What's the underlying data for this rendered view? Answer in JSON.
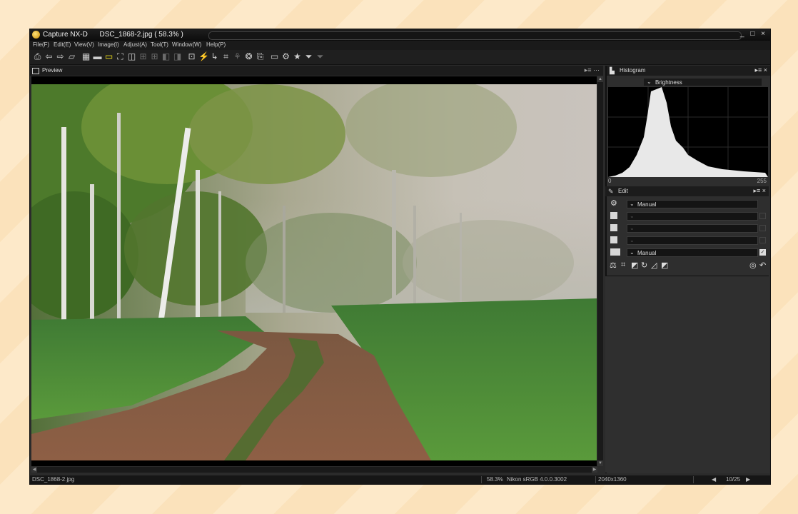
{
  "window": {
    "app_name": "Capture NX-D",
    "document_title": "DSC_1868-2.jpg ( 58.3% )",
    "controls": "_ □ ×"
  },
  "menu": [
    {
      "label": "File(F)",
      "key": "file"
    },
    {
      "label": "Edit(E)",
      "key": "edit"
    },
    {
      "label": "View(V)",
      "key": "view"
    },
    {
      "label": "Image(I)",
      "key": "image"
    },
    {
      "label": "Adjust(A)",
      "key": "adjust"
    },
    {
      "label": "Tool(T)",
      "key": "tool"
    },
    {
      "label": "Window(W)",
      "key": "window"
    },
    {
      "label": "Help(P)",
      "key": "help"
    }
  ],
  "toolbar": [
    {
      "name": "print-icon",
      "glyph": "⎙"
    },
    {
      "name": "back-icon",
      "glyph": "⇦"
    },
    {
      "name": "forward-icon",
      "glyph": "⇨"
    },
    {
      "name": "open-folder-icon",
      "glyph": "▱"
    },
    {
      "name": "thumbnail-grid-icon",
      "glyph": "▦"
    },
    {
      "name": "filmstrip-icon",
      "glyph": "▬"
    },
    {
      "name": "single-view-icon",
      "glyph": "▭",
      "selected": true
    },
    {
      "name": "full-screen-icon",
      "glyph": "⛶"
    },
    {
      "name": "compare-two-icon",
      "glyph": "◫"
    },
    {
      "name": "compare-four-icon",
      "glyph": "⊞",
      "dim": true
    },
    {
      "name": "compare-grid-icon",
      "glyph": "⊞",
      "dim": true
    },
    {
      "name": "before-after-icon",
      "glyph": "◧",
      "dim": true
    },
    {
      "name": "split-view-icon",
      "glyph": "◨",
      "dim": true
    },
    {
      "name": "focus-point-icon",
      "glyph": "⊡"
    },
    {
      "name": "highlights-icon",
      "glyph": "⚡",
      "dim": true
    },
    {
      "name": "straighten-icon",
      "glyph": "↳"
    },
    {
      "name": "crop-icon",
      "glyph": "⌗"
    },
    {
      "name": "color-picker-icon",
      "glyph": "⚘",
      "dim": true
    },
    {
      "name": "dust-off-icon",
      "glyph": "❂"
    },
    {
      "name": "copy-adjust-icon",
      "glyph": "⎘"
    },
    {
      "name": "slideshow-icon",
      "glyph": "▭"
    },
    {
      "name": "batch-process-icon",
      "glyph": "⚙"
    },
    {
      "name": "rating-star-icon",
      "glyph": "★"
    },
    {
      "name": "filter-icon",
      "glyph": "⏷"
    },
    {
      "name": "filter-off-icon",
      "glyph": "⏷",
      "dim": true
    }
  ],
  "preview": {
    "title": "Preview",
    "header_controls": "▸≡ ⋯"
  },
  "histogram": {
    "title": "Histogram",
    "channel": "Brightness",
    "scale_min": "0",
    "scale_max": "255",
    "header_controls": "▸≡ ×"
  },
  "edit": {
    "title": "Edit",
    "header_controls": "▸≡ ×",
    "rows": [
      {
        "icon": "gear-icon",
        "value": "Manual",
        "enabled": true,
        "checkbox": false
      },
      {
        "icon": "exposure-icon",
        "value": "",
        "enabled": false,
        "checkbox": false
      },
      {
        "icon": "white-balance-icon",
        "value": "",
        "enabled": false,
        "checkbox": false
      },
      {
        "icon": "picture-control-icon",
        "value": "",
        "enabled": false,
        "checkbox": false
      },
      {
        "icon": "levels-icon",
        "value": "Manual",
        "enabled": true,
        "checkbox": true
      }
    ]
  },
  "status_bar": {
    "filename": "DSC_1868-2.jpg",
    "zoom": "58.3%",
    "color_profile": "Nikon sRGB 4.0.0.3002",
    "dimensions": "2040x1360",
    "page": "10/25"
  },
  "colors": {
    "accent_selected": "#f2e21a",
    "panel_bg": "#2e2e2e"
  }
}
